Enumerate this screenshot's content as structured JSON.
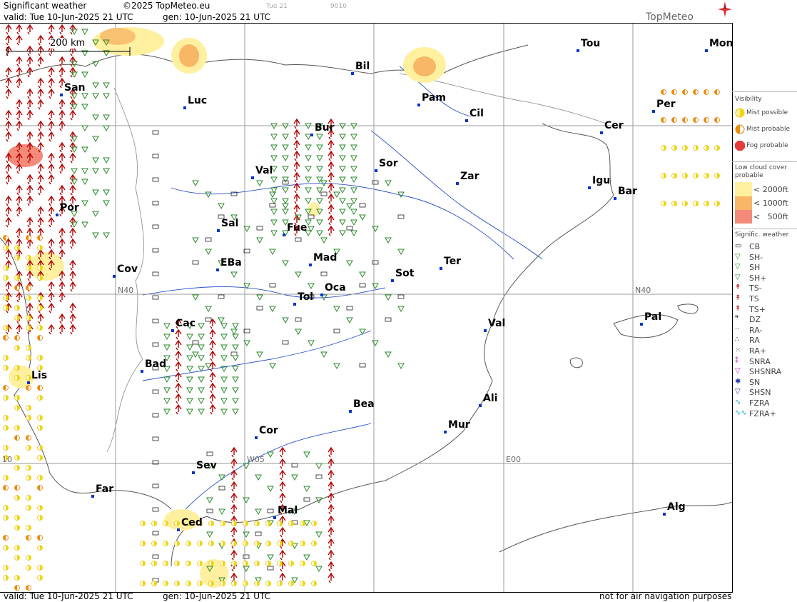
{
  "header": {
    "title": "Significant weather",
    "copyright": "©2025 TopMeteo.eu",
    "faint_day": "Tue 21",
    "faint_code": "9010",
    "valid": "valid:  Tue  10-Jun-2025  21 UTC",
    "gen": "gen: 10-Jun-2025 21 UTC",
    "brand": "TopMeteo"
  },
  "footer": {
    "valid": "valid:  Tue  10-Jun-2025  21 UTC",
    "gen": "gen: 10-Jun-2025 21 UTC",
    "disclaimer": "not for air navigation purposes"
  },
  "scale": {
    "label": "200 km"
  },
  "grid_labels": {
    "n40_left": "N40",
    "n40_right": "N40",
    "w05": "W05",
    "e00": "E00",
    "w10": "10"
  },
  "cities": [
    {
      "name": "Bil"
    },
    {
      "name": "Tou"
    },
    {
      "name": "Mon"
    },
    {
      "name": "San"
    },
    {
      "name": "Luc"
    },
    {
      "name": "Pam"
    },
    {
      "name": "Cil"
    },
    {
      "name": "Per"
    },
    {
      "name": "Bur"
    },
    {
      "name": "Cer"
    },
    {
      "name": "Sor"
    },
    {
      "name": "Val"
    },
    {
      "name": "Zar"
    },
    {
      "name": "Igu"
    },
    {
      "name": "Bar"
    },
    {
      "name": "Por"
    },
    {
      "name": "Sal"
    },
    {
      "name": "Fue"
    },
    {
      "name": "Mad"
    },
    {
      "name": "Ter"
    },
    {
      "name": "EBa"
    },
    {
      "name": "Cov"
    },
    {
      "name": "Sot"
    },
    {
      "name": "Tol"
    },
    {
      "name": "Oca"
    },
    {
      "name": "Pal"
    },
    {
      "name": "Cac"
    },
    {
      "name": "Val"
    },
    {
      "name": "Bad"
    },
    {
      "name": "Lis"
    },
    {
      "name": "Ali"
    },
    {
      "name": "Bea"
    },
    {
      "name": "Mur"
    },
    {
      "name": "Cor"
    },
    {
      "name": "Sev"
    },
    {
      "name": "Far"
    },
    {
      "name": "Alg"
    },
    {
      "name": "Mal"
    },
    {
      "name": "Ced"
    }
  ],
  "legend": {
    "visibility": {
      "title": "Visibility",
      "items": [
        "Mist possible",
        "Mist probable",
        "Fog probable"
      ]
    },
    "low_cloud": {
      "title": "Low cloud cover probable",
      "items": [
        "< 2000ft",
        "< 1000ft",
        "<   500ft"
      ],
      "colors": [
        "#fff0a0",
        "#f7b766",
        "#f38a7a"
      ]
    },
    "signific": {
      "title": "Signific. weather",
      "items": [
        "CB",
        "SH-",
        "SH",
        "SH+",
        "TS-",
        "TS",
        "TS+",
        "DZ",
        "RA-",
        "RA",
        "RA+",
        "SNRA",
        "SHSNRA",
        "SN",
        "SHSN",
        "FZRA",
        "FZRA+"
      ]
    }
  },
  "colors": {
    "city_marker": "#0033cc",
    "ts": "#b30000",
    "sh": "#2a8a2a",
    "mist": "#f3d700",
    "fog": "#e53d3d",
    "grid": "#999999"
  }
}
